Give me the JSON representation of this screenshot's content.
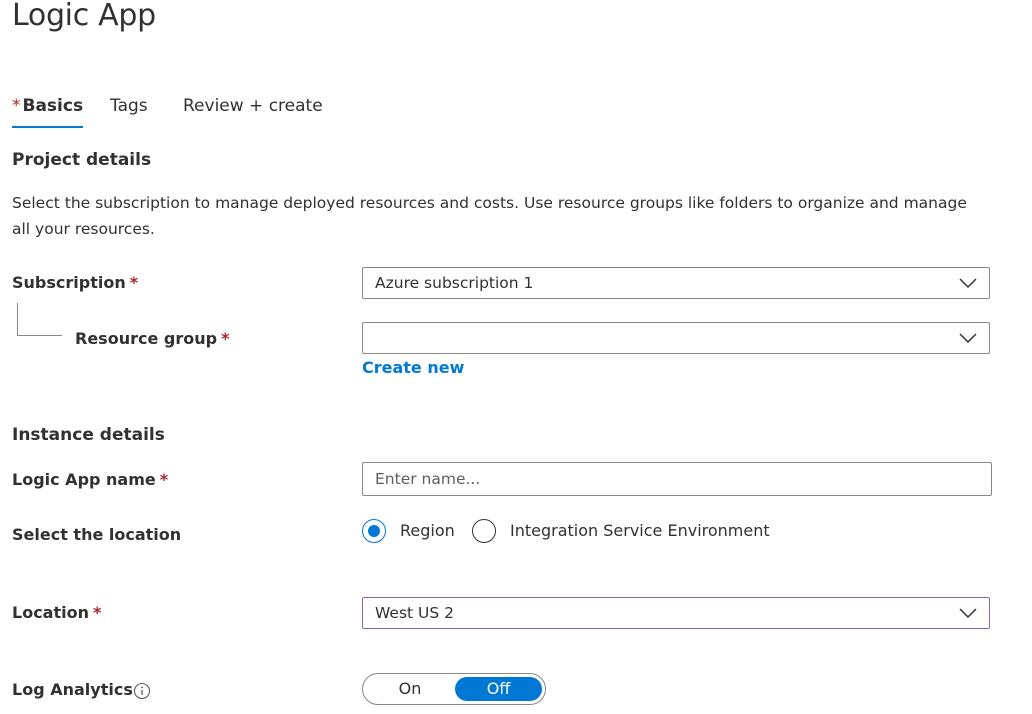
{
  "page": {
    "title": "Logic App"
  },
  "tabs": [
    {
      "label": "Basics",
      "required_marker": "*",
      "selected": true
    },
    {
      "label": "Tags",
      "selected": false
    },
    {
      "label": "Review + create",
      "selected": false
    }
  ],
  "project_details": {
    "title": "Project details",
    "description": "Select the subscription to manage deployed resources and costs. Use resource groups like folders to organize and manage all your resources.",
    "subscription": {
      "label": "Subscription",
      "required_marker": "*",
      "value": "Azure subscription 1"
    },
    "resource_group": {
      "label": "Resource group",
      "required_marker": "*",
      "value": "",
      "create_new_label": "Create new"
    }
  },
  "instance_details": {
    "title": "Instance details",
    "logic_app_name": {
      "label": "Logic App name",
      "required_marker": "*",
      "value": "",
      "placeholder": "Enter name..."
    },
    "select_location": {
      "label": "Select the location",
      "options": [
        {
          "label": "Region",
          "checked": true
        },
        {
          "label": "Integration Service Environment",
          "checked": false
        }
      ]
    },
    "location": {
      "label": "Location",
      "required_marker": "*",
      "value": "West US 2"
    },
    "log_analytics": {
      "label": "Log Analytics",
      "icon": "info-icon",
      "on_label": "On",
      "off_label": "Off",
      "selected": "Off"
    }
  },
  "colors": {
    "accent": "#0078d4",
    "required": "#a4262c",
    "focus_border": "#8764b8",
    "text": "#323130",
    "border": "#8a8886"
  }
}
